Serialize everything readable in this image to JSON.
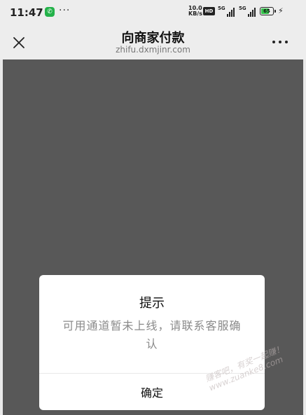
{
  "status_bar": {
    "time": "11:47",
    "dots": "···",
    "net_speed_value": "10.0",
    "net_speed_unit": "KB/s",
    "hd_label": "HD",
    "signal_labels": [
      "5G",
      "5G"
    ],
    "battery_level": "65",
    "colors": {
      "call_icon": "#24b24a",
      "battery": "#35c24b"
    }
  },
  "nav": {
    "title": "向商家付款",
    "url": "zhifu.dxmjinr.com"
  },
  "dialog": {
    "title": "提示",
    "message": "可用通道暂未上线，请联系客服确认",
    "confirm_label": "确定"
  },
  "watermark": {
    "line1": "赚客吧，有奖一起赚！",
    "line2": "www.zuanke8.com"
  },
  "icons": [
    "phone-call-icon",
    "close-icon",
    "more-icon",
    "charging-icon"
  ]
}
